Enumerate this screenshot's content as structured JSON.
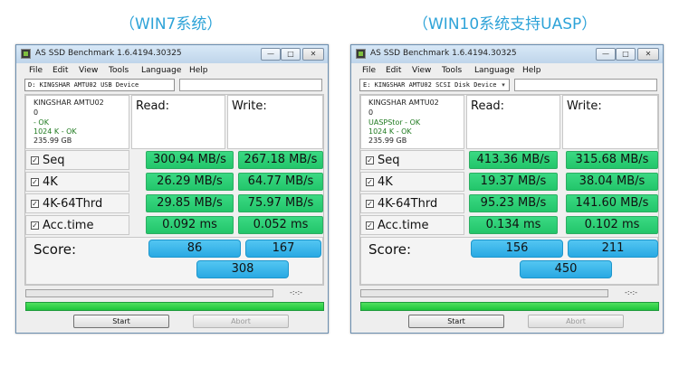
{
  "captions": {
    "left": "（WIN7系统）",
    "right": "（WIN10系统支持UASP）"
  },
  "windows": [
    {
      "title": "AS SSD Benchmark 1.6.4194.30325",
      "controls": {
        "minimize": "—",
        "maximize": "□",
        "close": "✕"
      },
      "menu": [
        "File",
        "Edit",
        "View",
        "Tools",
        "Language",
        "Help"
      ],
      "drive": "D: KINGSHAR AMTU02 USB Device",
      "drive_dropdown_icon": "chevron-down-icon",
      "info": {
        "name": "KINGSHAR AMTU02",
        "firmware": "0",
        "driver": " - OK",
        "alignment": "1024 K - OK",
        "size": "235.99 GB"
      },
      "headers": {
        "read": "Read:",
        "write": "Write:"
      },
      "rows": [
        {
          "label": "Seq",
          "checked": "✓",
          "read": "300.94 MB/s",
          "write": "267.18 MB/s"
        },
        {
          "label": "4K",
          "checked": "✓",
          "read": "26.29 MB/s",
          "write": "64.77 MB/s"
        },
        {
          "label": "4K-64Thrd",
          "checked": "✓",
          "read": "29.85 MB/s",
          "write": "75.97 MB/s"
        },
        {
          "label": "Acc.time",
          "checked": "✓",
          "read": "0.092 ms",
          "write": "0.052 ms"
        }
      ],
      "score": {
        "label": "Score:",
        "read": "86",
        "write": "167",
        "total": "308"
      },
      "timer": "-:-:-",
      "progress_small": 0.0,
      "progress_big": 1.0,
      "buttons": {
        "start": "Start",
        "abort": "Abort"
      }
    },
    {
      "title": "AS SSD Benchmark 1.6.4194.30325",
      "controls": {
        "minimize": "—",
        "maximize": "□",
        "close": "✕"
      },
      "menu": [
        "File",
        "Edit",
        "View",
        "Tools",
        "Language",
        "Help"
      ],
      "drive": "E: KINGSHAR AMTU02 SCSI Disk Device",
      "drive_dropdown_icon": "chevron-down-icon",
      "info": {
        "name": "KINGSHAR AMTU02",
        "firmware": "0",
        "driver": "UASPStor - OK",
        "alignment": "1024 K - OK",
        "size": "235.99 GB"
      },
      "headers": {
        "read": "Read:",
        "write": "Write:"
      },
      "rows": [
        {
          "label": "Seq",
          "checked": "✓",
          "read": "413.36 MB/s",
          "write": "315.68 MB/s"
        },
        {
          "label": "4K",
          "checked": "✓",
          "read": "19.37 MB/s",
          "write": "38.04 MB/s"
        },
        {
          "label": "4K-64Thrd",
          "checked": "✓",
          "read": "95.23 MB/s",
          "write": "141.60 MB/s"
        },
        {
          "label": "Acc.time",
          "checked": "✓",
          "read": "0.134 ms",
          "write": "0.102 ms"
        }
      ],
      "score": {
        "label": "Score:",
        "read": "156",
        "write": "211",
        "total": "450"
      },
      "timer": "-:-:-",
      "progress_small": 0.0,
      "progress_big": 1.0,
      "buttons": {
        "start": "Start",
        "abort": "Abort"
      }
    }
  ],
  "colors": {
    "caption": "#2ea3d8",
    "result_green": "#22c56a",
    "score_blue": "#29a9e3",
    "progress_green": "#1cc43a"
  }
}
